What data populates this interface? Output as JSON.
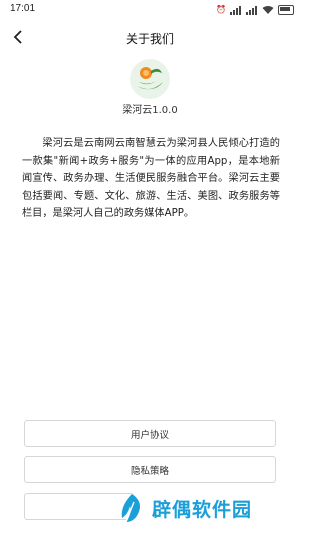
{
  "status_bar": {
    "time": "17:01",
    "icons": [
      "alarm-icon",
      "signal-icon",
      "signal-icon",
      "wifi-icon",
      "battery-icon"
    ]
  },
  "header": {
    "title": "关于我们",
    "back_icon": "chevron-left-icon"
  },
  "app": {
    "logo_icon": "app-logo-icon",
    "version_label": "梁河云1.0.0"
  },
  "about": {
    "text": "梁河云是云南网云南智慧云为梁河县人民倾心打造的一款集\"新闻+政务+服务\"为一体的应用App，是本地新闻宣传、政务办理、生活便民服务融合平台。梁河云主要包括要闻、专题、文化、旅游、生活、美图、政务服务等栏目，是梁河人自己的政务媒体APP。"
  },
  "buttons": {
    "user_agreement": "用户协议",
    "privacy_policy": "隐私策略",
    "third": ""
  },
  "watermark": {
    "text": "辟偶软件园",
    "icon": "leaf-logo-icon"
  },
  "colors": {
    "watermark": "#1a9fd9",
    "logo_orange": "#f08a24",
    "logo_green": "#5aa845"
  }
}
